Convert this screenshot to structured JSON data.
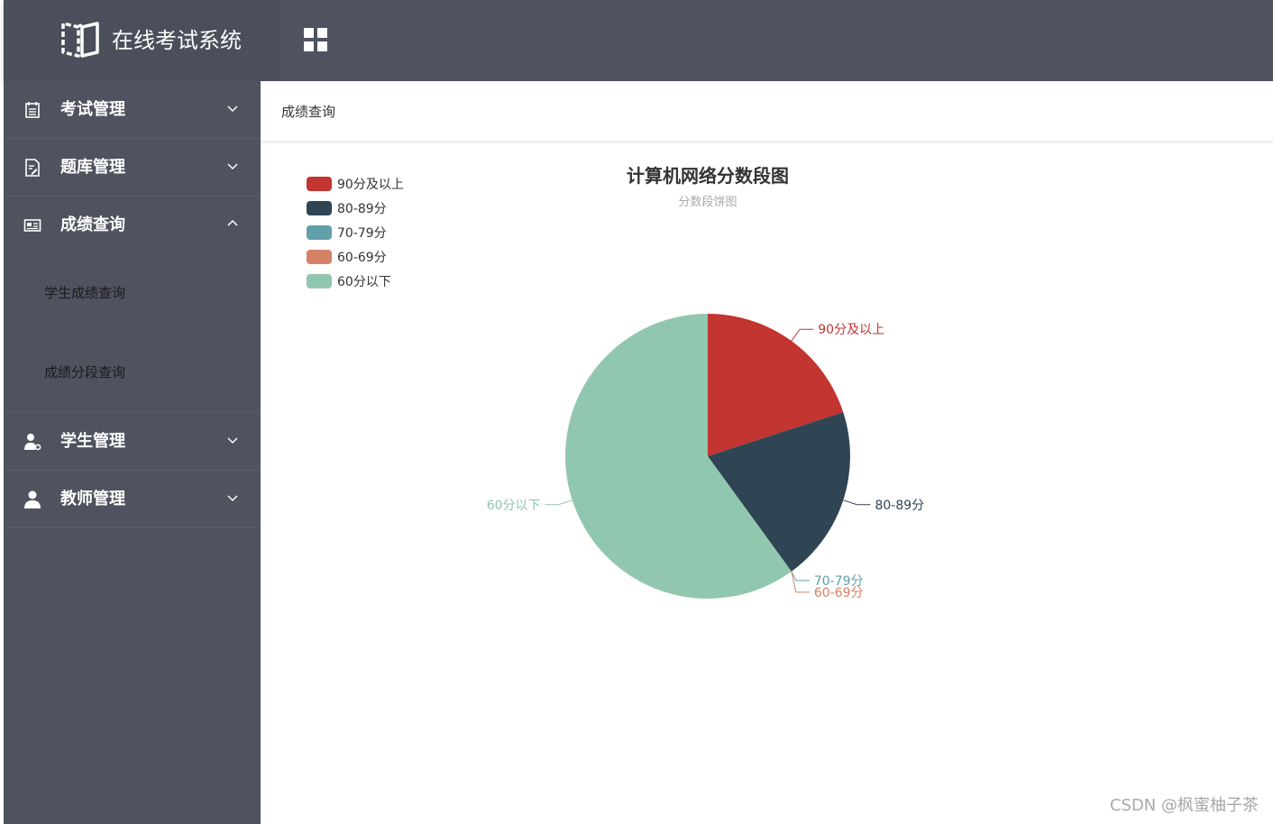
{
  "app": {
    "title": "在线考试系统",
    "logo_icon": "open-book-icon",
    "menu_toggle_icon": "grid-icon"
  },
  "sidebar": {
    "items": [
      {
        "label": "考试管理",
        "icon": "calendar-list-icon",
        "expanded": false
      },
      {
        "label": "题库管理",
        "icon": "document-edit-icon",
        "expanded": false
      },
      {
        "label": "成绩查询",
        "icon": "id-card-icon",
        "expanded": true,
        "children": [
          "学生成绩查询",
          "成绩分段查询"
        ]
      },
      {
        "label": "学生管理",
        "icon": "user-gear-icon",
        "expanded": false
      },
      {
        "label": "教师管理",
        "icon": "user-icon",
        "expanded": false
      }
    ]
  },
  "breadcrumb": {
    "current": "成绩查询"
  },
  "chart_data": {
    "type": "pie",
    "title": "计算机网络分数段图",
    "subtitle": "分数段饼图",
    "legend_position": "top-left",
    "categories": [
      "90分及以上",
      "80-89分",
      "70-79分",
      "60-69分",
      "60分以下"
    ],
    "values": [
      2,
      2,
      0,
      0,
      6
    ],
    "colors": [
      "#c23531",
      "#2f4554",
      "#61a0a8",
      "#d48265",
      "#91c7ae"
    ]
  },
  "watermark": "CSDN @枫蜜柚子茶"
}
